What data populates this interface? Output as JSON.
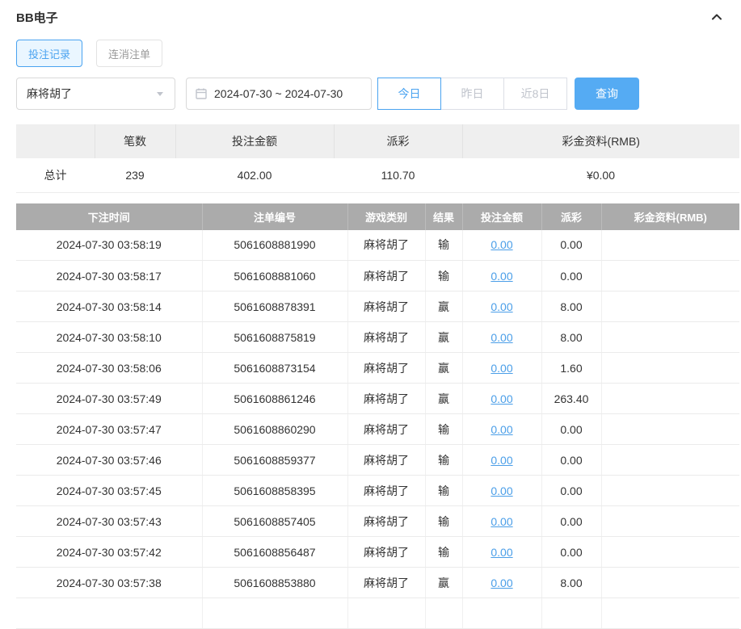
{
  "header": {
    "title": "BB电子"
  },
  "tabs": [
    {
      "label": "投注记录",
      "active": true
    },
    {
      "label": "连消注单",
      "active": false
    }
  ],
  "filters": {
    "game_select": {
      "value": "麻将胡了"
    },
    "date_range": {
      "value": "2024-07-30 ~ 2024-07-30"
    },
    "quick_buttons": [
      {
        "label": "今日",
        "active": true
      },
      {
        "label": "昨日",
        "active": false
      },
      {
        "label": "近8日",
        "active": false
      }
    ],
    "search_label": "查询"
  },
  "summary": {
    "headers": [
      "",
      "笔数",
      "投注金额",
      "派彩",
      "彩金资料(RMB)"
    ],
    "row": {
      "label": "总计",
      "count": "239",
      "bet_amount": "402.00",
      "payout": "110.70",
      "bonus": "¥0.00"
    }
  },
  "table": {
    "headers": [
      "下注时间",
      "注单编号",
      "游戏类别",
      "结果",
      "投注金额",
      "派彩",
      "彩金资料(RMB)"
    ],
    "rows": [
      {
        "time": "2024-07-30 03:58:19",
        "order_id": "5061608881990",
        "game": "麻将胡了",
        "result": "输",
        "bet": "0.00",
        "payout": "0.00",
        "bonus": ""
      },
      {
        "time": "2024-07-30 03:58:17",
        "order_id": "5061608881060",
        "game": "麻将胡了",
        "result": "输",
        "bet": "0.00",
        "payout": "0.00",
        "bonus": ""
      },
      {
        "time": "2024-07-30 03:58:14",
        "order_id": "5061608878391",
        "game": "麻将胡了",
        "result": "赢",
        "bet": "0.00",
        "payout": "8.00",
        "bonus": ""
      },
      {
        "time": "2024-07-30 03:58:10",
        "order_id": "5061608875819",
        "game": "麻将胡了",
        "result": "赢",
        "bet": "0.00",
        "payout": "8.00",
        "bonus": ""
      },
      {
        "time": "2024-07-30 03:58:06",
        "order_id": "5061608873154",
        "game": "麻将胡了",
        "result": "赢",
        "bet": "0.00",
        "payout": "1.60",
        "bonus": ""
      },
      {
        "time": "2024-07-30 03:57:49",
        "order_id": "5061608861246",
        "game": "麻将胡了",
        "result": "赢",
        "bet": "0.00",
        "payout": "263.40",
        "bonus": ""
      },
      {
        "time": "2024-07-30 03:57:47",
        "order_id": "5061608860290",
        "game": "麻将胡了",
        "result": "输",
        "bet": "0.00",
        "payout": "0.00",
        "bonus": ""
      },
      {
        "time": "2024-07-30 03:57:46",
        "order_id": "5061608859377",
        "game": "麻将胡了",
        "result": "输",
        "bet": "0.00",
        "payout": "0.00",
        "bonus": ""
      },
      {
        "time": "2024-07-30 03:57:45",
        "order_id": "5061608858395",
        "game": "麻将胡了",
        "result": "输",
        "bet": "0.00",
        "payout": "0.00",
        "bonus": ""
      },
      {
        "time": "2024-07-30 03:57:43",
        "order_id": "5061608857405",
        "game": "麻将胡了",
        "result": "输",
        "bet": "0.00",
        "payout": "0.00",
        "bonus": ""
      },
      {
        "time": "2024-07-30 03:57:42",
        "order_id": "5061608856487",
        "game": "麻将胡了",
        "result": "输",
        "bet": "0.00",
        "payout": "0.00",
        "bonus": ""
      },
      {
        "time": "2024-07-30 03:57:38",
        "order_id": "5061608853880",
        "game": "麻将胡了",
        "result": "赢",
        "bet": "0.00",
        "payout": "8.00",
        "bonus": ""
      }
    ]
  },
  "colors": {
    "accent": "#4aa3f0",
    "accent_light": "#eaf6ff",
    "button_bg": "#55abf3",
    "table_header_bg": "#ababab",
    "link": "#4a9ee8"
  }
}
